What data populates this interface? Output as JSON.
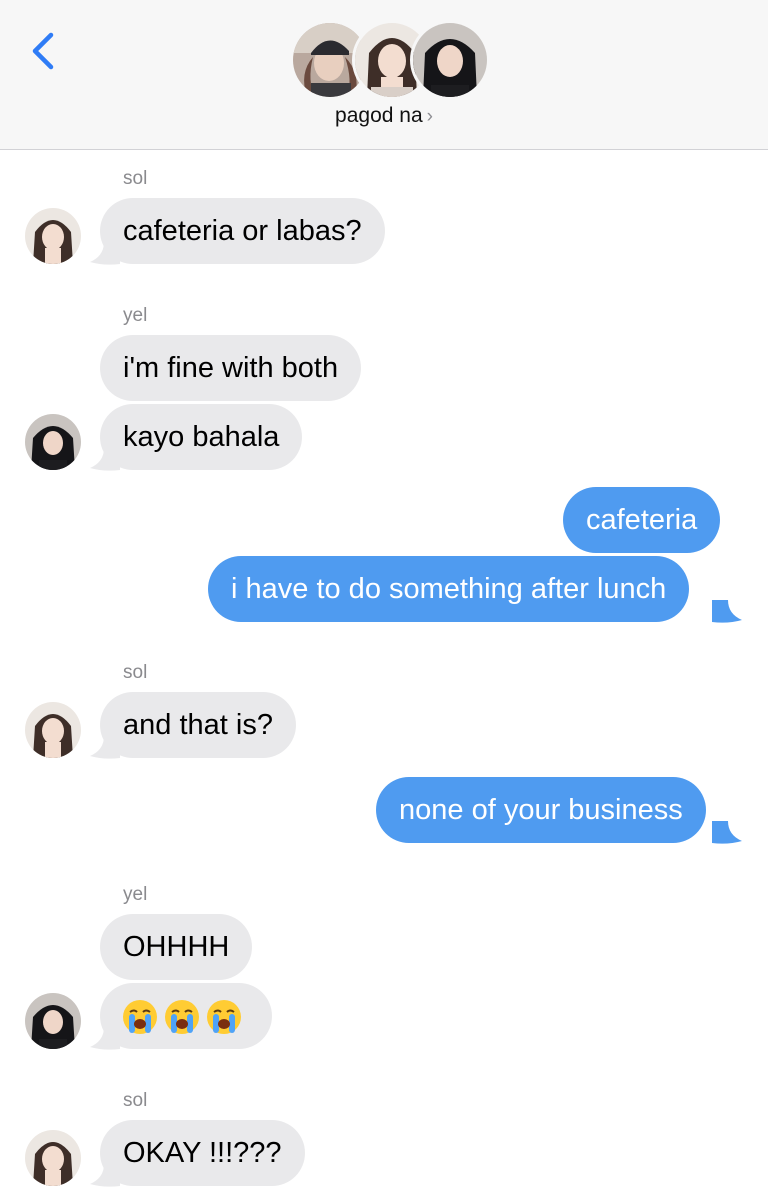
{
  "header": {
    "group_name": "pagod na",
    "chevron": "›",
    "back_icon": "chevron-left-icon"
  },
  "colors": {
    "incoming_bubble": "#e9e9eb",
    "outgoing_bubble": "#4f9bf0",
    "back_accent": "#2f7cf6",
    "sender_label": "#8a8a8e"
  },
  "messages": [
    {
      "sender": "sol",
      "text": "cafeteria or labas?",
      "direction": "incoming"
    },
    {
      "sender": "yel",
      "text": "i'm fine with both",
      "direction": "incoming"
    },
    {
      "sender": "yel",
      "text": "kayo bahala",
      "direction": "incoming"
    },
    {
      "sender": "me",
      "text": "cafeteria",
      "direction": "outgoing"
    },
    {
      "sender": "me",
      "text": "i have to do something after lunch",
      "direction": "outgoing"
    },
    {
      "sender": "sol",
      "text": "and that is?",
      "direction": "incoming"
    },
    {
      "sender": "me",
      "text": "none of your business",
      "direction": "outgoing"
    },
    {
      "sender": "yel",
      "text": "OHHHH",
      "direction": "incoming"
    },
    {
      "sender": "yel",
      "text": "😭😭😭",
      "direction": "incoming",
      "icon": "loudly-crying-face-icon"
    },
    {
      "sender": "sol",
      "text": "OKAY !!!???",
      "direction": "incoming"
    }
  ],
  "sender_labels": {
    "sol_1": "sol",
    "yel_1": "yel",
    "sol_2": "sol",
    "yel_2": "yel",
    "sol_3": "sol"
  }
}
